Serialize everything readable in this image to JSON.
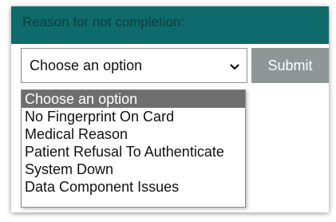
{
  "form": {
    "label": "Reason for not completion:",
    "select": {
      "selected": "Choose an option",
      "options": [
        "Choose an option",
        "No Fingerprint On Card",
        "Medical Reason",
        "Patient Refusal To Authenticate",
        "System Down",
        "Data Component Issues"
      ]
    },
    "submit_label": "Submit"
  },
  "colors": {
    "header_bg": "#0f6a6b",
    "submit_bg": "#8f9796",
    "option_highlight": "#6e6e6e"
  },
  "icons": {
    "select_arrow": "chevron-down-icon"
  }
}
